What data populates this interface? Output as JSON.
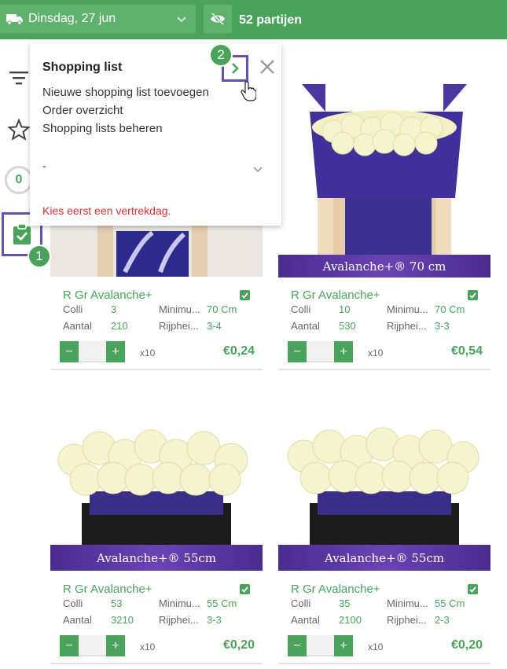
{
  "topbar": {
    "date_label": "Dinsdag, 27 jun",
    "lot_count": "52 partijen"
  },
  "sidebar": {
    "counter": "0"
  },
  "steps": {
    "step1": "1",
    "step2": "2"
  },
  "popup": {
    "title": "Shopping list",
    "menu": [
      "Nieuwe shopping list toevoegen",
      "Order overzicht",
      "Shopping lists beheren"
    ],
    "select_value": "-",
    "warning": "Kies eerst een vertrekdag."
  },
  "products": [
    {
      "name": "R Gr Avalanche+",
      "colli_label": "Colli",
      "colli": "3",
      "aantal_label": "Aantal",
      "aantal": "210",
      "min_label": "Minimu...",
      "min": "70 Cm",
      "rijp_label": "Rijphei...",
      "rijp": "3-4",
      "qty_minus": "−",
      "qty_plus": "+",
      "multiplier": "x10",
      "price": "€0,24"
    },
    {
      "name": "R Gr Avalanche+",
      "banner": "Avalanche+® 70 cm",
      "colli_label": "Colli",
      "colli": "10",
      "aantal_label": "Aantal",
      "aantal": "530",
      "min_label": "Minimu...",
      "min": "70 Cm",
      "rijp_label": "Rijphei...",
      "rijp": "3-3",
      "qty_minus": "−",
      "qty_plus": "+",
      "multiplier": "x10",
      "price": "€0,54"
    },
    {
      "name": "R Gr Avalanche+",
      "banner": "Avalanche+® 55cm",
      "colli_label": "Colli",
      "colli": "53",
      "aantal_label": "Aantal",
      "aantal": "3210",
      "min_label": "Minimu...",
      "min": "55 Cm",
      "rijp_label": "Rijphei...",
      "rijp": "3-3",
      "qty_minus": "−",
      "qty_plus": "+",
      "multiplier": "x10",
      "price": "€0,20"
    },
    {
      "name": "R Gr Avalanche+",
      "banner": "Avalanche+® 55cm",
      "colli_label": "Colli",
      "colli": "35",
      "aantal_label": "Aantal",
      "aantal": "2100",
      "min_label": "Minimu...",
      "min": "55 Cm",
      "rijp_label": "Rijphei...",
      "rijp": "2-3",
      "qty_minus": "−",
      "qty_plus": "+",
      "multiplier": "x10",
      "price": "€0,20"
    }
  ],
  "icons": {
    "truck": "truck-icon",
    "eye_off": "eye-off-icon",
    "filter": "filter-icon",
    "star": "star-icon",
    "clipboard": "clipboard-check-icon",
    "next": "chevron-right-icon",
    "close": "close-icon",
    "cursor": "hand-pointer-icon"
  },
  "colors": {
    "brand_green": "#49a35a",
    "highlight_purple": "#6b4fb0",
    "warning_red": "#e02f2f"
  }
}
